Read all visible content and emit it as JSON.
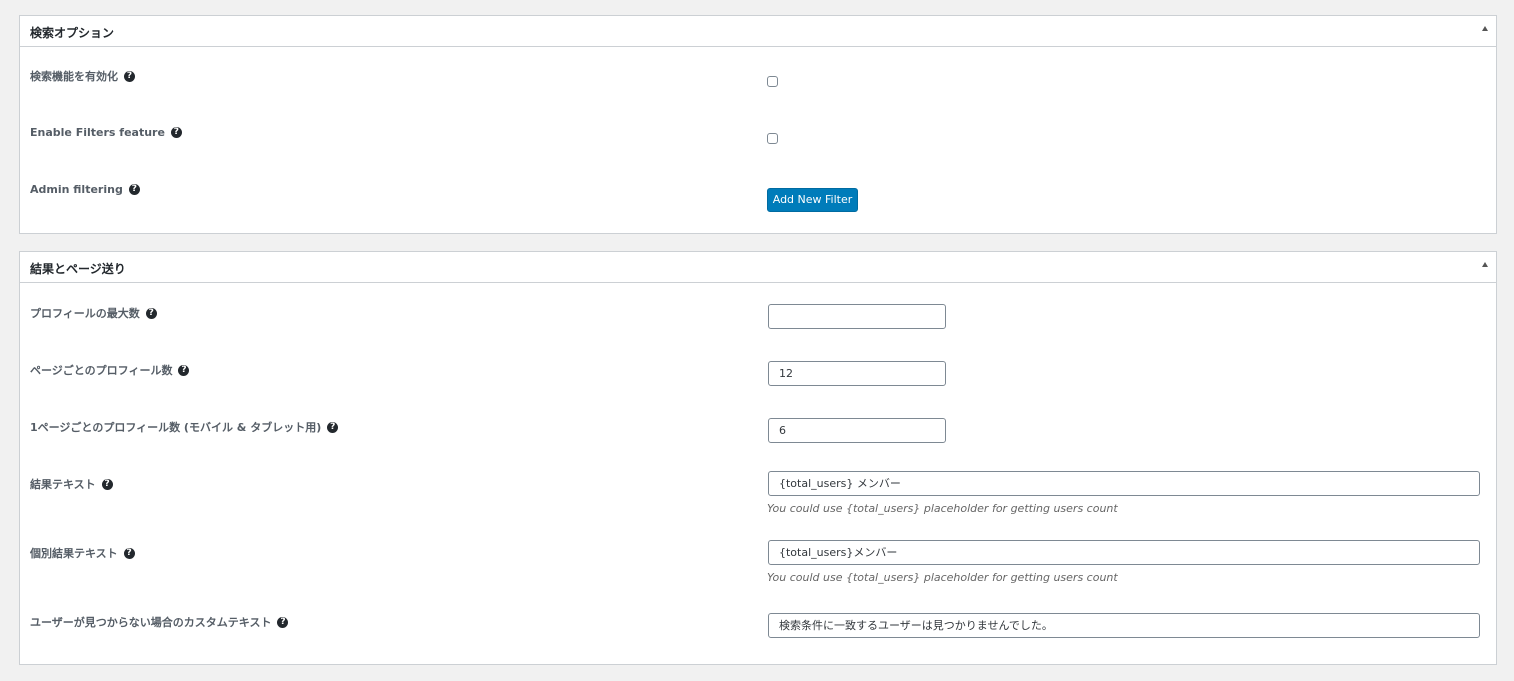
{
  "search_options": {
    "title": "検索オプション",
    "fields": {
      "enable_search": {
        "label": "検索機能を有効化",
        "checked": false
      },
      "enable_filters": {
        "label": "Enable Filters feature",
        "checked": false
      },
      "admin_filtering": {
        "label": "Admin filtering",
        "button_label": "Add New Filter"
      }
    }
  },
  "results_pagination": {
    "title": "結果とページ送り",
    "fields": {
      "max_profiles": {
        "label": "プロフィールの最大数",
        "value": ""
      },
      "profiles_per_page": {
        "label": "ページごとのプロフィール数",
        "value": "12"
      },
      "profiles_per_page_mobile": {
        "label": "1ページごとのプロフィール数 (モバイル & タブレット用)",
        "value": "6"
      },
      "results_text": {
        "label": "結果テキスト",
        "value": "{total_users} メンバー",
        "description": "You could use {total_users} placeholder for getting users count"
      },
      "single_result_text": {
        "label": "個別結果テキスト",
        "value": "{total_users}メンバー",
        "description": "You could use {total_users} placeholder for getting users count"
      },
      "no_users_text": {
        "label": "ユーザーが見つからない場合のカスタムテキスト",
        "value": "検索条件に一致するユーザーは見つかりませんでした。"
      }
    }
  },
  "icons": {
    "help": "?",
    "toggle": "triangle-up-icon"
  },
  "colors": {
    "primary_button": "#007cba",
    "background": "#f1f1f1",
    "panel_border": "#ccd0d4"
  }
}
